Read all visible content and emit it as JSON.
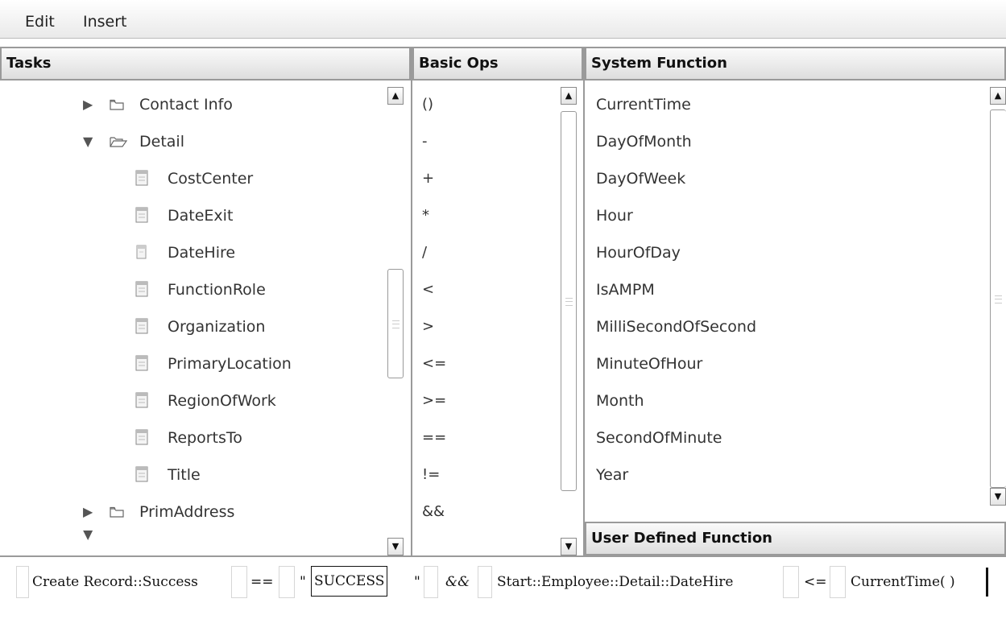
{
  "menu": {
    "edit": "Edit",
    "insert": "Insert"
  },
  "tasks": {
    "title": "Tasks",
    "items": [
      {
        "label": "Contact Info",
        "kind": "folder-collapsed"
      },
      {
        "label": "Detail",
        "kind": "folder-expanded"
      },
      {
        "label": "CostCenter",
        "kind": "leaf"
      },
      {
        "label": "DateExit",
        "kind": "leaf"
      },
      {
        "label": "DateHire",
        "kind": "leaf"
      },
      {
        "label": "FunctionRole",
        "kind": "leaf"
      },
      {
        "label": "Organization",
        "kind": "leaf"
      },
      {
        "label": "PrimaryLocation",
        "kind": "leaf"
      },
      {
        "label": "RegionOfWork",
        "kind": "leaf"
      },
      {
        "label": "ReportsTo",
        "kind": "leaf"
      },
      {
        "label": "Title",
        "kind": "leaf"
      },
      {
        "label": "PrimAddress",
        "kind": "folder-collapsed"
      }
    ]
  },
  "basic_ops": {
    "title": "Basic Ops",
    "items": [
      "()",
      "-",
      "+",
      "*",
      "/",
      "<",
      ">",
      "<=",
      ">=",
      "==",
      "!=",
      "&&"
    ]
  },
  "system_function": {
    "title": "System Function",
    "items": [
      "CurrentTime",
      "DayOfMonth",
      "DayOfWeek",
      "Hour",
      "HourOfDay",
      "IsAMPM",
      "MilliSecondOfSecond",
      "MinuteOfHour",
      "Month",
      "SecondOfMinute",
      "Year"
    ]
  },
  "user_defined_function": {
    "title": "User Defined Function"
  },
  "expression": {
    "tokens": [
      "Create Record::Success",
      "==",
      "\"",
      "SUCCESS",
      "\"",
      "&&",
      "Start::Employee::Detail::DateHire",
      "<=",
      "CurrentTime( )"
    ]
  },
  "colors": {
    "header_border": "#9a9a9a",
    "header_bg": "#dedede",
    "accent_text": "#111111"
  }
}
